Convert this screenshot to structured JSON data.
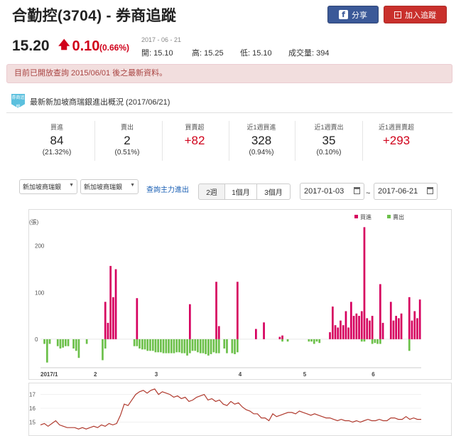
{
  "header": {
    "title": "合勤控(3704) - 券商追蹤",
    "share_label": "分享",
    "track_label": "加入追蹤",
    "share_icon": "f"
  },
  "quote": {
    "price": "15.20",
    "change": "0.10",
    "change_pct": "(0.66%)",
    "date": "2017 - 06 - 21",
    "open": "開: 15.10",
    "high": "高: 15.25",
    "low": "低: 15.10",
    "volume": "成交量: 394",
    "up_color": "#d0021b"
  },
  "notice": "目前已開放查詢 2015/06/01 後之最新資料。",
  "section": {
    "icon_text": "券商追蹤",
    "title": "最新新加坡商瑞銀進出概況 (2017/06/21)"
  },
  "stats": [
    {
      "label": "買進",
      "value": "84",
      "sub": "(21.32%)"
    },
    {
      "label": "賣出",
      "value": "2",
      "sub": "(0.51%)"
    },
    {
      "label": "買賣超",
      "value": "+82",
      "sub": ""
    },
    {
      "label": "近1週買進",
      "value": "328",
      "sub": "(0.94%)"
    },
    {
      "label": "近1週賣出",
      "value": "35",
      "sub": "(0.10%)"
    },
    {
      "label": "近1週買賣超",
      "value": "+293",
      "sub": ""
    }
  ],
  "controls": {
    "broker_select_1": "新加坡商瑞銀",
    "broker_select_2": "新加坡商瑞銀",
    "query_link": "查詢主力進出",
    "periods": [
      "2週",
      "1個月",
      "3個月"
    ],
    "date_from": "2017-01-03",
    "date_sep": "~",
    "date_to": "2017-06-21"
  },
  "chart_data": [
    {
      "type": "bar",
      "ylabel": "(張)",
      "y_ticks": [
        0,
        100,
        200
      ],
      "ylim": [
        -55,
        265
      ],
      "x_ticks": [
        "2017/1",
        "2",
        "3",
        "4",
        "5",
        "6"
      ],
      "legend": "top-right",
      "series": [
        {
          "name": "買進",
          "color": "#d6005f",
          "values": [
            0,
            0,
            0,
            0,
            0,
            0,
            0,
            0,
            0,
            0,
            0,
            0,
            0,
            0,
            0,
            0,
            0,
            0,
            0,
            0,
            0,
            0,
            0,
            0,
            80,
            35,
            157,
            90,
            150,
            0,
            0,
            0,
            0,
            0,
            0,
            0,
            88,
            0,
            0,
            0,
            0,
            0,
            0,
            0,
            0,
            0,
            0,
            0,
            0,
            0,
            0,
            0,
            0,
            0,
            0,
            0,
            75,
            0,
            0,
            0,
            0,
            0,
            0,
            0,
            0,
            0,
            123,
            28,
            0,
            0,
            0,
            0,
            0,
            0,
            123,
            0,
            0,
            0,
            0,
            0,
            0,
            22,
            0,
            0,
            36,
            0,
            0,
            0,
            0,
            0,
            5,
            8,
            0,
            0,
            0,
            0,
            0,
            0,
            0,
            0,
            0,
            0,
            0,
            0,
            0,
            0,
            0,
            0,
            0,
            15,
            70,
            30,
            25,
            40,
            30,
            60,
            25,
            80,
            50,
            55,
            50,
            60,
            240,
            45,
            40,
            50,
            0,
            0,
            118,
            35,
            0,
            0,
            80,
            40,
            50,
            45,
            55,
            0,
            0,
            90,
            40,
            60,
            45,
            85
          ]
        },
        {
          "name": "賣出",
          "color": "#6cc04a",
          "values": [
            0,
            -10,
            -50,
            -10,
            0,
            0,
            -15,
            -20,
            -18,
            -15,
            -15,
            0,
            -20,
            -25,
            -40,
            0,
            0,
            -10,
            0,
            0,
            0,
            0,
            0,
            -45,
            -20,
            0,
            0,
            0,
            0,
            0,
            0,
            0,
            0,
            0,
            0,
            -15,
            -15,
            -20,
            -22,
            -22,
            -25,
            -25,
            -25,
            -28,
            -28,
            -28,
            -30,
            -30,
            -30,
            -30,
            -30,
            -28,
            -28,
            -30,
            -30,
            -35,
            -30,
            -25,
            -25,
            -28,
            -30,
            -30,
            -32,
            -35,
            -32,
            -28,
            -30,
            -30,
            0,
            -20,
            -30,
            0,
            -30,
            -32,
            -28,
            0,
            0,
            0,
            0,
            0,
            0,
            0,
            0,
            0,
            0,
            0,
            0,
            0,
            0,
            0,
            0,
            -5,
            0,
            -5,
            0,
            0,
            0,
            0,
            0,
            0,
            0,
            -5,
            -5,
            -10,
            -5,
            -8,
            0,
            0,
            0,
            0,
            0,
            0,
            0,
            0,
            0,
            0,
            0,
            0,
            0,
            0,
            0,
            -5,
            -5,
            0,
            0,
            -10,
            -8,
            -10,
            -10,
            0,
            0,
            0,
            0,
            0,
            0,
            0,
            0,
            0,
            0,
            -25,
            0,
            0,
            0,
            0
          ]
        }
      ]
    },
    {
      "type": "line",
      "y_ticks": [
        15,
        16,
        17
      ],
      "ylim": [
        14.2,
        17.6
      ],
      "series": [
        {
          "color": "#b03a2e",
          "values": [
            14.8,
            14.9,
            14.7,
            14.9,
            15.1,
            14.8,
            14.7,
            14.6,
            14.6,
            14.6,
            14.5,
            14.6,
            14.5,
            14.6,
            14.7,
            14.6,
            14.8,
            14.7,
            14.9,
            14.8,
            14.9,
            15.5,
            16.3,
            16.2,
            16.6,
            17.0,
            17.2,
            17.3,
            17.1,
            17.3,
            17.4,
            17.0,
            17.2,
            17.1,
            17.0,
            16.8,
            16.9,
            16.7,
            16.8,
            16.5,
            16.6,
            16.8,
            16.9,
            17.0,
            16.6,
            16.7,
            16.5,
            16.6,
            16.3,
            16.2,
            16.5,
            16.3,
            16.4,
            16.1,
            15.9,
            15.8,
            15.6,
            15.6,
            15.3,
            15.3,
            15.1,
            15.6,
            15.4,
            15.5,
            15.6,
            15.7,
            15.7,
            15.6,
            15.8,
            15.7,
            15.6,
            15.5,
            15.6,
            15.5,
            15.4,
            15.3,
            15.3,
            15.2,
            15.1,
            15.2,
            15.1,
            15.1,
            15.0,
            15.1,
            15.0,
            15.1,
            15.2,
            15.1,
            15.1,
            15.2,
            15.1,
            15.1,
            15.3,
            15.3,
            15.2,
            15.2,
            15.4,
            15.2,
            15.3,
            15.2,
            15.2
          ]
        }
      ]
    }
  ]
}
